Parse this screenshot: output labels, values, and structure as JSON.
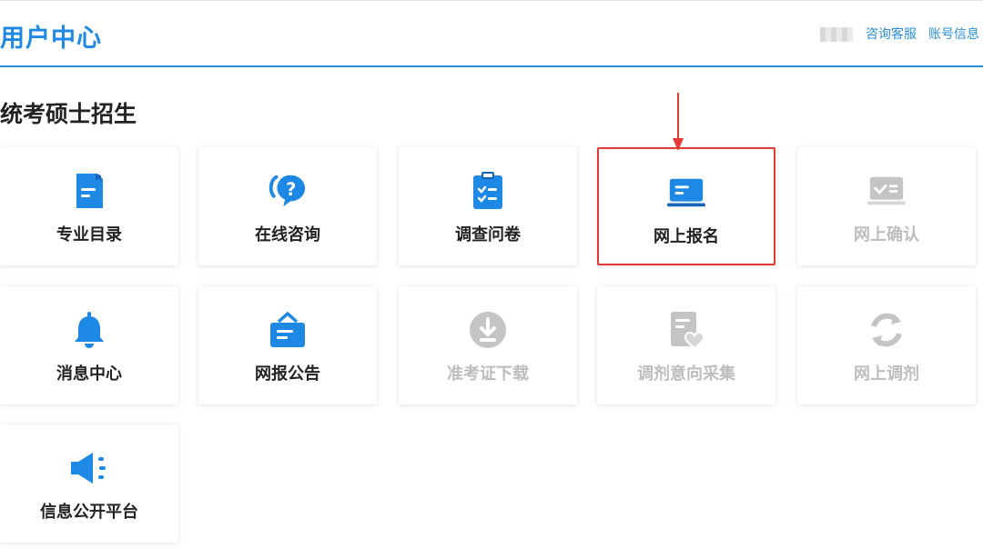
{
  "header": {
    "title": "用户中心",
    "links": {
      "consult": "咨询客服",
      "account": "账号信息"
    }
  },
  "section": {
    "title": "统考硕士招生"
  },
  "cards": [
    {
      "label": "专业目录",
      "icon": "document-icon",
      "enabled": true
    },
    {
      "label": "在线咨询",
      "icon": "chat-question-icon",
      "enabled": true
    },
    {
      "label": "调查问卷",
      "icon": "clipboard-check-icon",
      "enabled": true
    },
    {
      "label": "网上报名",
      "icon": "laptop-icon",
      "enabled": true,
      "highlighted": true
    },
    {
      "label": "网上确认",
      "icon": "confirm-card-icon",
      "enabled": false
    },
    {
      "label": "消息中心",
      "icon": "bell-icon",
      "enabled": true
    },
    {
      "label": "网报公告",
      "icon": "announcement-board-icon",
      "enabled": true
    },
    {
      "label": "准考证下载",
      "icon": "download-icon",
      "enabled": false
    },
    {
      "label": "调剂意向采集",
      "icon": "document-heart-icon",
      "enabled": false
    },
    {
      "label": "网上调剂",
      "icon": "refresh-icon",
      "enabled": false
    },
    {
      "label": "信息公开平台",
      "icon": "megaphone-icon",
      "enabled": true
    }
  ],
  "colors": {
    "accent": "#1e88e5",
    "disabled": "#bdbdbd",
    "highlight": "#e53935"
  }
}
